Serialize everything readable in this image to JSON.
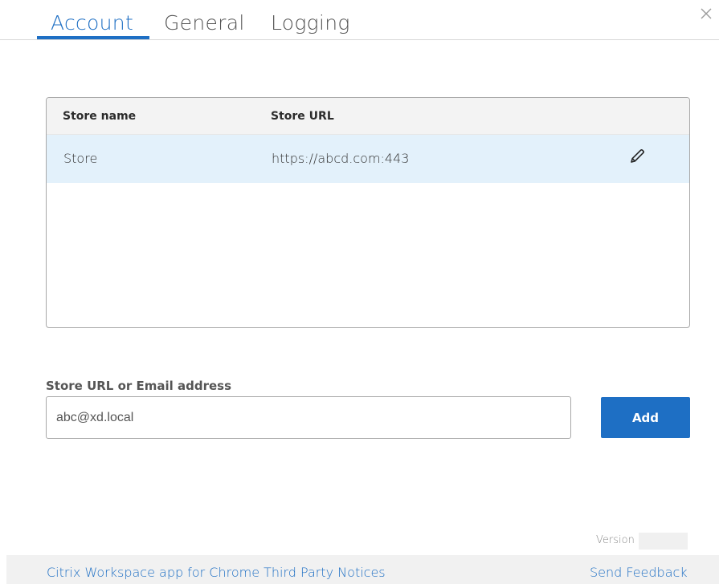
{
  "tabs": [
    {
      "label": "Account",
      "active": true
    },
    {
      "label": "General",
      "active": false
    },
    {
      "label": "Logging",
      "active": false
    }
  ],
  "store_table": {
    "columns": {
      "name": "Store name",
      "url": "Store URL"
    },
    "rows": [
      {
        "name": "Store",
        "url": "https://abcd.com:443",
        "action_icon": "pencil-icon"
      }
    ]
  },
  "add_store": {
    "label": "Store URL or Email address",
    "value": "",
    "placeholder": "abc@xd.local",
    "button_label": "Add"
  },
  "version": {
    "label": "Version",
    "value": ""
  },
  "footer": {
    "notices_link": "Citrix Workspace app for Chrome Third Party Notices",
    "feedback_link": "Send Feedback"
  },
  "colors": {
    "accent": "#1e6fc4",
    "selected_row": "#e3f1fb",
    "footer_bg": "#f1f1f1"
  }
}
